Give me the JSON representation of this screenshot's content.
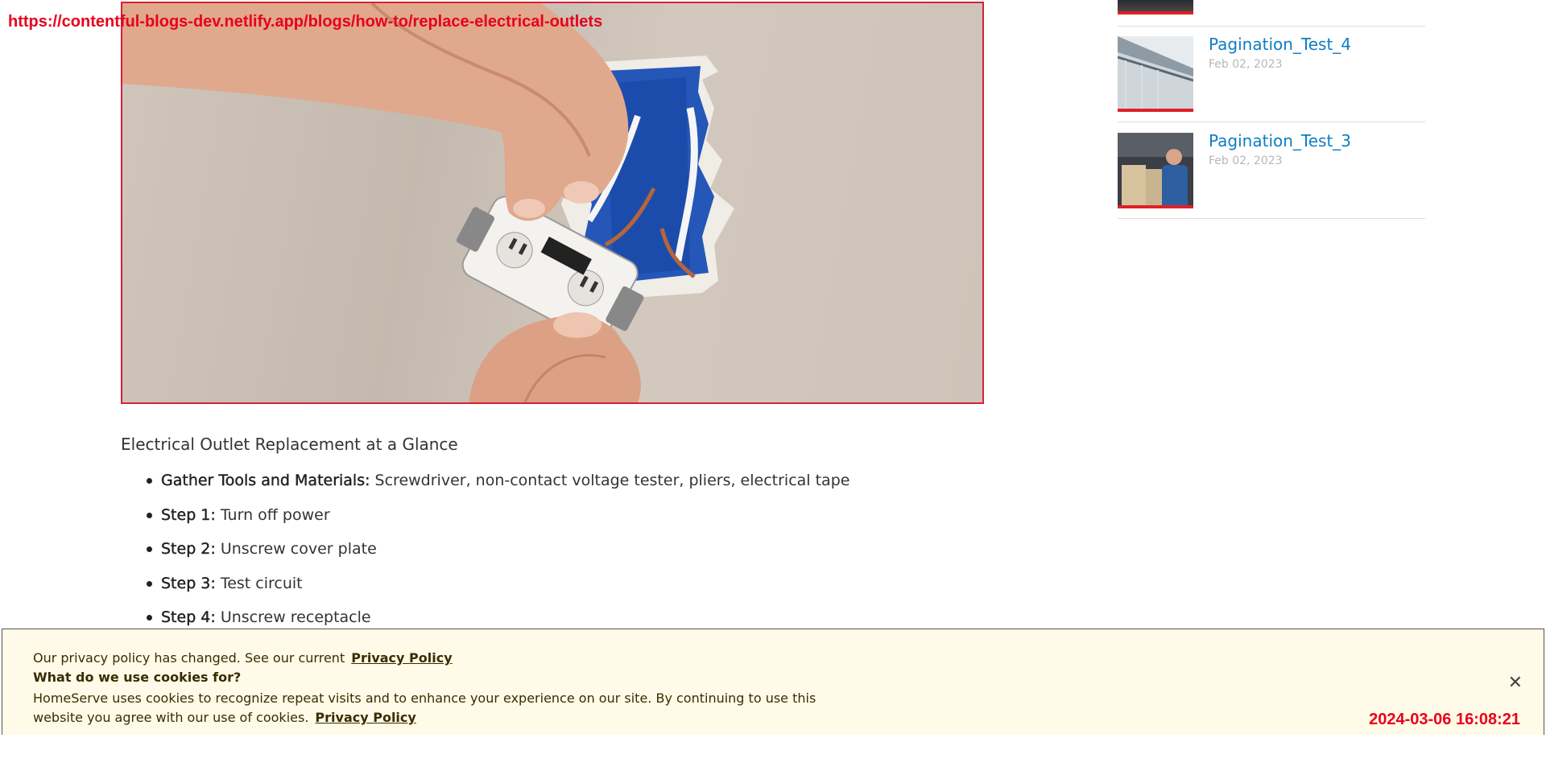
{
  "overlay": {
    "url": "https://contentful-blogs-dev.netlify.app/blogs/how-to/replace-electrical-outlets",
    "timestamp": "2024-03-06 16:08:21"
  },
  "hero": {
    "icon": "hands-wiring-outlet-photo"
  },
  "article": {
    "glance_title": "Electrical Outlet Replacement at a Glance",
    "steps": [
      {
        "label": "Gather Tools and Materials:",
        "text": " Screwdriver, non-contact voltage tester, pliers, electrical tape"
      },
      {
        "label": "Step 1:",
        "text": " Turn off power"
      },
      {
        "label": "Step 2:",
        "text": " Unscrew cover plate"
      },
      {
        "label": "Step 3:",
        "text": " Test circuit"
      },
      {
        "label": "Step 4:",
        "text": " Unscrew receptacle"
      }
    ]
  },
  "sidebar": {
    "items": [
      {
        "title": "Pagination_Test_4",
        "date": "Feb 02, 2023",
        "thumb_icon": "house-gutter-photo"
      },
      {
        "title": "Pagination_Test_3",
        "date": "Feb 02, 2023",
        "thumb_icon": "technician-photo"
      }
    ]
  },
  "cookie": {
    "line1": "Our privacy policy has changed. See our current",
    "line1_link": "Privacy Policy",
    "heading": "What do we use cookies for?",
    "body": "HomeServe uses cookies to recognize repeat visits and to enhance your experience on our site. By continuing to use this website you agree with our use of cookies.",
    "body_link": "Privacy Policy",
    "close_icon": "close-icon",
    "close_label": "✕"
  },
  "colors": {
    "link_blue": "#0e7dc2",
    "accent_red": "#e21f26",
    "cookie_bg": "#fffbe8"
  }
}
